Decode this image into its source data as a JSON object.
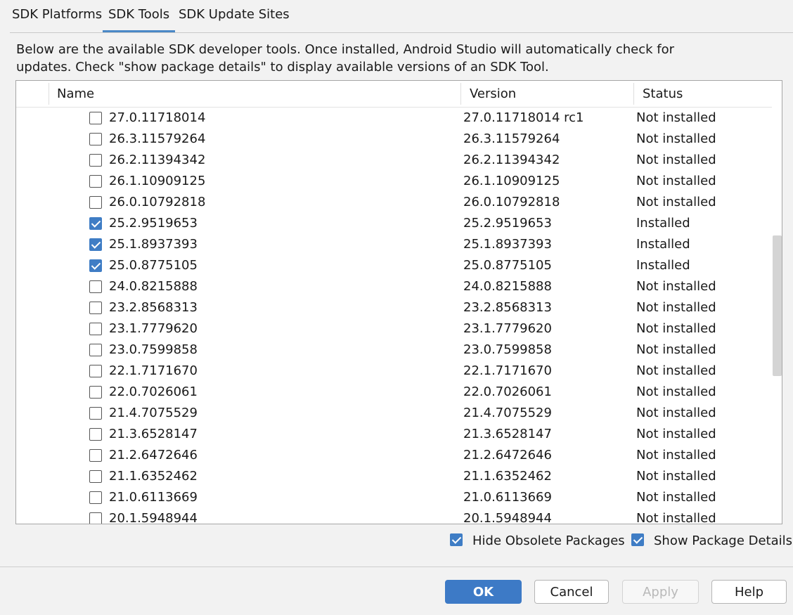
{
  "tabs": [
    {
      "label": "SDK Platforms",
      "active": false
    },
    {
      "label": "SDK Tools",
      "active": true
    },
    {
      "label": "SDK Update Sites",
      "active": false
    }
  ],
  "description": {
    "line1": "Below are the available SDK developer tools. Once installed, Android Studio will automatically check for",
    "line2": "updates. Check \"show package details\" to display available versions of an SDK Tool."
  },
  "table": {
    "columns": [
      "Name",
      "Version",
      "Status"
    ],
    "rows": [
      {
        "name": "27.0.11718014",
        "version": "27.0.11718014 rc1",
        "status": "Not installed",
        "checked": false
      },
      {
        "name": "26.3.11579264",
        "version": "26.3.11579264",
        "status": "Not installed",
        "checked": false
      },
      {
        "name": "26.2.11394342",
        "version": "26.2.11394342",
        "status": "Not installed",
        "checked": false
      },
      {
        "name": "26.1.10909125",
        "version": "26.1.10909125",
        "status": "Not installed",
        "checked": false
      },
      {
        "name": "26.0.10792818",
        "version": "26.0.10792818",
        "status": "Not installed",
        "checked": false
      },
      {
        "name": "25.2.9519653",
        "version": "25.2.9519653",
        "status": "Installed",
        "checked": true
      },
      {
        "name": "25.1.8937393",
        "version": "25.1.8937393",
        "status": "Installed",
        "checked": true
      },
      {
        "name": "25.0.8775105",
        "version": "25.0.8775105",
        "status": "Installed",
        "checked": true
      },
      {
        "name": "24.0.8215888",
        "version": "24.0.8215888",
        "status": "Not installed",
        "checked": false
      },
      {
        "name": "23.2.8568313",
        "version": "23.2.8568313",
        "status": "Not installed",
        "checked": false
      },
      {
        "name": "23.1.7779620",
        "version": "23.1.7779620",
        "status": "Not installed",
        "checked": false
      },
      {
        "name": "23.0.7599858",
        "version": "23.0.7599858",
        "status": "Not installed",
        "checked": false
      },
      {
        "name": "22.1.7171670",
        "version": "22.1.7171670",
        "status": "Not installed",
        "checked": false
      },
      {
        "name": "22.0.7026061",
        "version": "22.0.7026061",
        "status": "Not installed",
        "checked": false
      },
      {
        "name": "21.4.7075529",
        "version": "21.4.7075529",
        "status": "Not installed",
        "checked": false
      },
      {
        "name": "21.3.6528147",
        "version": "21.3.6528147",
        "status": "Not installed",
        "checked": false
      },
      {
        "name": "21.2.6472646",
        "version": "21.2.6472646",
        "status": "Not installed",
        "checked": false
      },
      {
        "name": "21.1.6352462",
        "version": "21.1.6352462",
        "status": "Not installed",
        "checked": false
      },
      {
        "name": "21.0.6113669",
        "version": "21.0.6113669",
        "status": "Not installed",
        "checked": false
      },
      {
        "name": "20.1.5948944",
        "version": "20.1.5948944",
        "status": "Not installed",
        "checked": false
      }
    ]
  },
  "options": {
    "hide_obsolete": {
      "label": "Hide Obsolete Packages",
      "checked": true
    },
    "show_details": {
      "label": "Show Package Details",
      "checked": true
    }
  },
  "buttons": {
    "ok": "OK",
    "cancel": "Cancel",
    "apply": "Apply",
    "help": "Help"
  },
  "colors": {
    "accent": "#3d7ac6",
    "tab_underline": "#4a88c7"
  }
}
